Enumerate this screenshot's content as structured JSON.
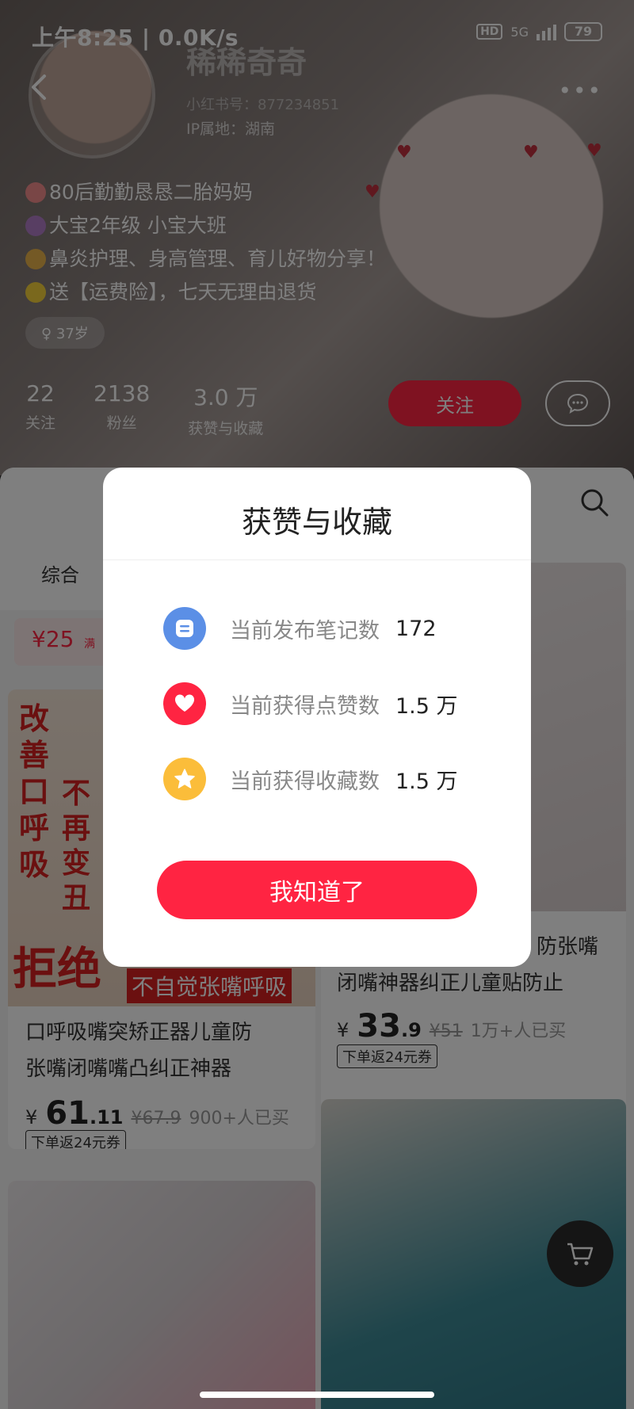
{
  "status_bar": {
    "time": "上午8:25 | 0.0K/s",
    "network": "5G",
    "hd": "HD",
    "battery": "79"
  },
  "profile": {
    "nickname": "稀稀奇奇",
    "rednote_id": "小红书号：877234851",
    "ip_location": "IP属地：湖南",
    "bio_lines": [
      "80后勤勤恳恳二胎妈妈",
      "大宝2年级  小宝大班",
      "鼻炎护理、身高管理、育儿好物分享！",
      "送【运费险】，七天无理由退货"
    ],
    "age_tag": "37岁",
    "stats": [
      {
        "value": "22",
        "label": "关注"
      },
      {
        "value": "2138",
        "label": "粉丝"
      },
      {
        "value": "3.0 万",
        "label": "获赞与收藏"
      }
    ],
    "follow_label": "关注"
  },
  "content": {
    "tab_all": "综合",
    "coupon_price": "¥25",
    "coupon_condition": "满"
  },
  "products": [
    {
      "image_text_1": "改善口呼吸",
      "image_text_2": "不再变丑",
      "image_text_3": "拒绝",
      "image_text_4": "不自觉张嘴呼吸",
      "title_line1": "口呼吸嘴突矫正器儿童防",
      "title_line2": "张嘴闭嘴嘴凸纠正神器",
      "price_symbol": "¥",
      "price_int": "61",
      "price_dec": ".11",
      "price_old": "¥67.9",
      "sold": "900+人已买",
      "badge": "下单返24元券"
    },
    {
      "title_line1": "防张嘴",
      "title_line2": "闭嘴神器纠正儿童贴防止",
      "price_symbol": "¥",
      "price_int": "33",
      "price_dec": ".9",
      "price_old": "¥51",
      "sold": "1万+人已买",
      "badge": "下单返24元券"
    }
  ],
  "modal": {
    "title": "获赞与收藏",
    "rows": [
      {
        "label": "当前发布笔记数",
        "value": "172",
        "icon": "note-icon",
        "color": "#5b8fe6"
      },
      {
        "label": "当前获得点赞数",
        "value": "1.5 万",
        "icon": "heart-icon",
        "color": "#ff2442"
      },
      {
        "label": "当前获得收藏数",
        "value": "1.5 万",
        "icon": "star-icon",
        "color": "#fbbd3a"
      }
    ],
    "confirm_label": "我知道了"
  },
  "colors": {
    "accent": "#ff2442",
    "note_blue": "#5b8fe6",
    "star_yellow": "#fbbd3a"
  }
}
